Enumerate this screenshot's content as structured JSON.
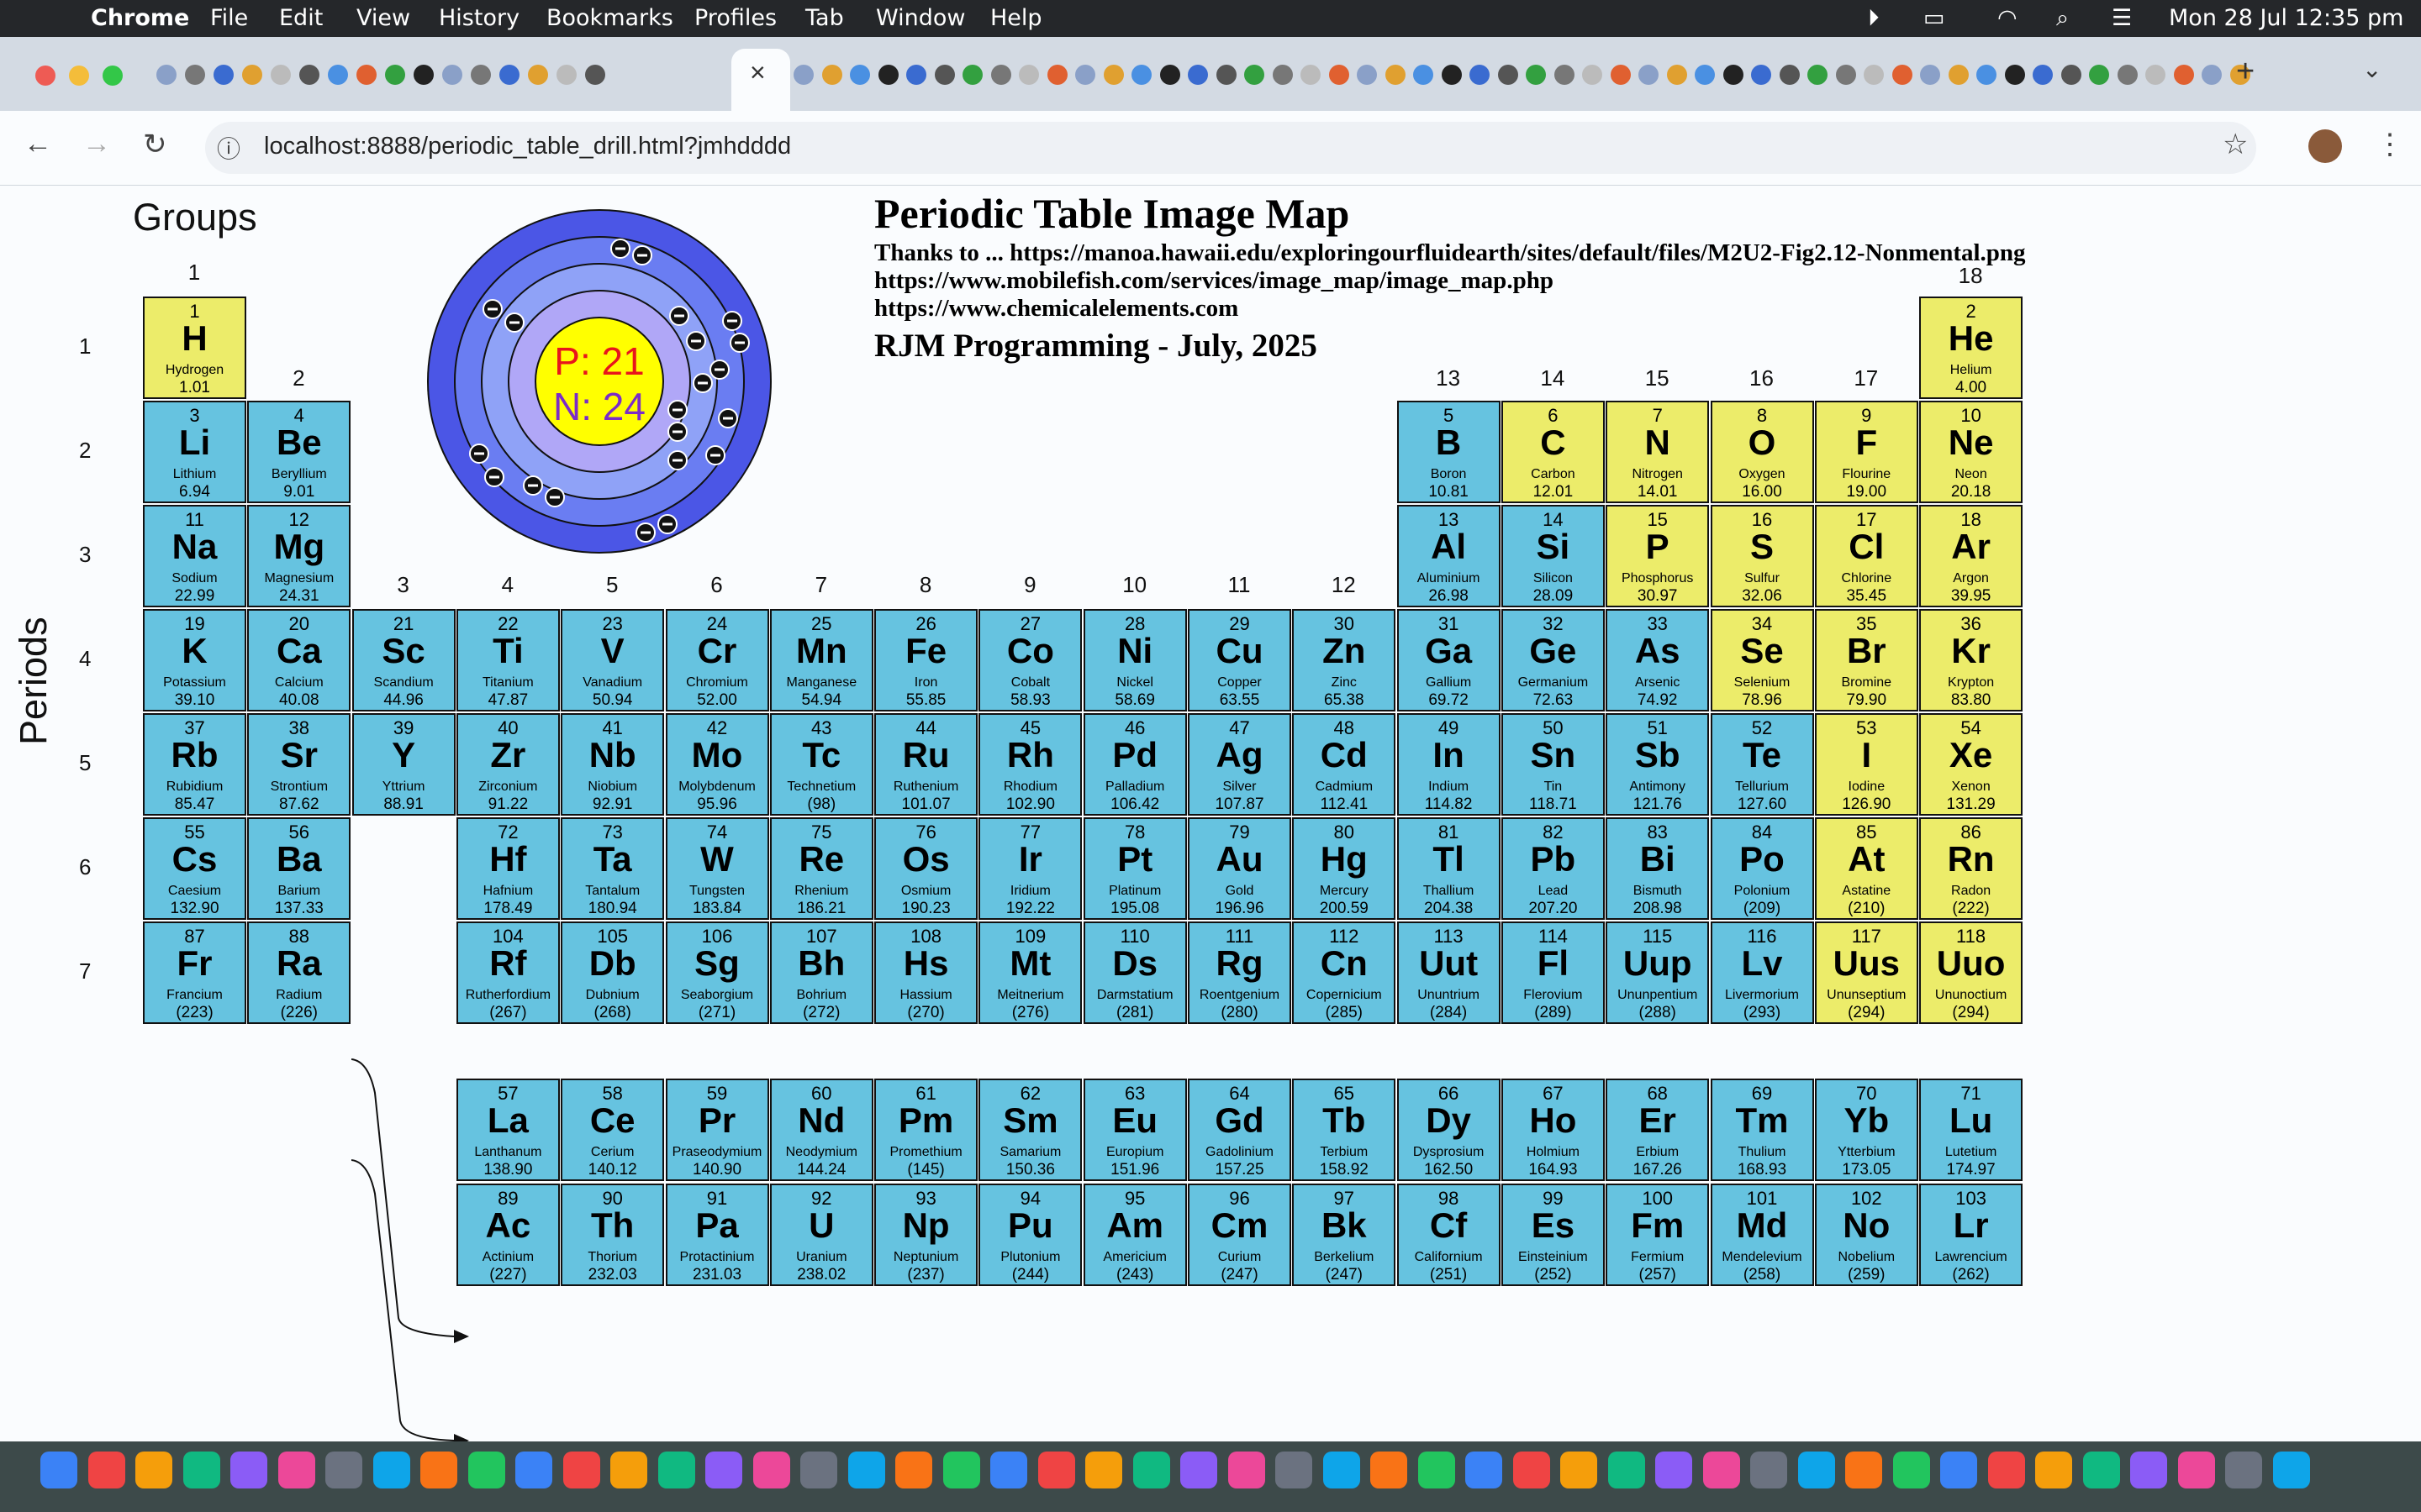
{
  "menubar": {
    "app": "Chrome",
    "items": [
      "File",
      "Edit",
      "View",
      "History",
      "Bookmarks",
      "Profiles",
      "Tab",
      "Window",
      "Help"
    ],
    "clock": "Mon 28 Jul  12:35 pm"
  },
  "browser": {
    "url": "localhost:8888/periodic_table_drill.html?jmhdddd",
    "close_tab": "×",
    "new_tab": "+"
  },
  "page": {
    "title": "Periodic Table Image Map",
    "thanks_line1": "Thanks to ... https://manoa.hawaii.edu/exploringourfluidearth/sites/default/files/M2U2-Fig2.12-Nonmental.png",
    "thanks_line2": "https://www.mobilefish.com/services/image_map/image_map.php",
    "thanks_line3": "https://www.chemicalelements.com",
    "author": "RJM Programming - July, 2025",
    "groups_label": "Groups",
    "periods_label": "Periods",
    "atom": {
      "protons": "P: 21",
      "neutrons": "N: 24"
    }
  },
  "group_numbers": [
    "1",
    "2",
    "3",
    "4",
    "5",
    "6",
    "7",
    "8",
    "9",
    "10",
    "11",
    "12",
    "13",
    "14",
    "15",
    "16",
    "17",
    "18"
  ],
  "period_numbers": [
    "1",
    "2",
    "3",
    "4",
    "5",
    "6",
    "7"
  ],
  "colors": {
    "metal": "#66c3e0",
    "nonmetal": "#ecec6a"
  },
  "elements": [
    {
      "n": "1",
      "s": "H",
      "name": "Hydrogen",
      "m": "1.01",
      "g": 1,
      "p": 1,
      "c": "y"
    },
    {
      "n": "2",
      "s": "He",
      "name": "Helium",
      "m": "4.00",
      "g": 18,
      "p": 1,
      "c": "y"
    },
    {
      "n": "3",
      "s": "Li",
      "name": "Lithium",
      "m": "6.94",
      "g": 1,
      "p": 2,
      "c": "b"
    },
    {
      "n": "4",
      "s": "Be",
      "name": "Beryllium",
      "m": "9.01",
      "g": 2,
      "p": 2,
      "c": "b"
    },
    {
      "n": "5",
      "s": "B",
      "name": "Boron",
      "m": "10.81",
      "g": 13,
      "p": 2,
      "c": "b"
    },
    {
      "n": "6",
      "s": "C",
      "name": "Carbon",
      "m": "12.01",
      "g": 14,
      "p": 2,
      "c": "y"
    },
    {
      "n": "7",
      "s": "N",
      "name": "Nitrogen",
      "m": "14.01",
      "g": 15,
      "p": 2,
      "c": "y"
    },
    {
      "n": "8",
      "s": "O",
      "name": "Oxygen",
      "m": "16.00",
      "g": 16,
      "p": 2,
      "c": "y"
    },
    {
      "n": "9",
      "s": "F",
      "name": "Flourine",
      "m": "19.00",
      "g": 17,
      "p": 2,
      "c": "y"
    },
    {
      "n": "10",
      "s": "Ne",
      "name": "Neon",
      "m": "20.18",
      "g": 18,
      "p": 2,
      "c": "y"
    },
    {
      "n": "11",
      "s": "Na",
      "name": "Sodium",
      "m": "22.99",
      "g": 1,
      "p": 3,
      "c": "b"
    },
    {
      "n": "12",
      "s": "Mg",
      "name": "Magnesium",
      "m": "24.31",
      "g": 2,
      "p": 3,
      "c": "b"
    },
    {
      "n": "13",
      "s": "Al",
      "name": "Aluminium",
      "m": "26.98",
      "g": 13,
      "p": 3,
      "c": "b"
    },
    {
      "n": "14",
      "s": "Si",
      "name": "Silicon",
      "m": "28.09",
      "g": 14,
      "p": 3,
      "c": "b"
    },
    {
      "n": "15",
      "s": "P",
      "name": "Phosphorus",
      "m": "30.97",
      "g": 15,
      "p": 3,
      "c": "y"
    },
    {
      "n": "16",
      "s": "S",
      "name": "Sulfur",
      "m": "32.06",
      "g": 16,
      "p": 3,
      "c": "y"
    },
    {
      "n": "17",
      "s": "Cl",
      "name": "Chlorine",
      "m": "35.45",
      "g": 17,
      "p": 3,
      "c": "y"
    },
    {
      "n": "18",
      "s": "Ar",
      "name": "Argon",
      "m": "39.95",
      "g": 18,
      "p": 3,
      "c": "y"
    },
    {
      "n": "19",
      "s": "K",
      "name": "Potassium",
      "m": "39.10",
      "g": 1,
      "p": 4,
      "c": "b"
    },
    {
      "n": "20",
      "s": "Ca",
      "name": "Calcium",
      "m": "40.08",
      "g": 2,
      "p": 4,
      "c": "b"
    },
    {
      "n": "21",
      "s": "Sc",
      "name": "Scandium",
      "m": "44.96",
      "g": 3,
      "p": 4,
      "c": "b"
    },
    {
      "n": "22",
      "s": "Ti",
      "name": "Titanium",
      "m": "47.87",
      "g": 4,
      "p": 4,
      "c": "b"
    },
    {
      "n": "23",
      "s": "V",
      "name": "Vanadium",
      "m": "50.94",
      "g": 5,
      "p": 4,
      "c": "b"
    },
    {
      "n": "24",
      "s": "Cr",
      "name": "Chromium",
      "m": "52.00",
      "g": 6,
      "p": 4,
      "c": "b"
    },
    {
      "n": "25",
      "s": "Mn",
      "name": "Manganese",
      "m": "54.94",
      "g": 7,
      "p": 4,
      "c": "b"
    },
    {
      "n": "26",
      "s": "Fe",
      "name": "Iron",
      "m": "55.85",
      "g": 8,
      "p": 4,
      "c": "b"
    },
    {
      "n": "27",
      "s": "Co",
      "name": "Cobalt",
      "m": "58.93",
      "g": 9,
      "p": 4,
      "c": "b"
    },
    {
      "n": "28",
      "s": "Ni",
      "name": "Nickel",
      "m": "58.69",
      "g": 10,
      "p": 4,
      "c": "b"
    },
    {
      "n": "29",
      "s": "Cu",
      "name": "Copper",
      "m": "63.55",
      "g": 11,
      "p": 4,
      "c": "b"
    },
    {
      "n": "30",
      "s": "Zn",
      "name": "Zinc",
      "m": "65.38",
      "g": 12,
      "p": 4,
      "c": "b"
    },
    {
      "n": "31",
      "s": "Ga",
      "name": "Gallium",
      "m": "69.72",
      "g": 13,
      "p": 4,
      "c": "b"
    },
    {
      "n": "32",
      "s": "Ge",
      "name": "Germanium",
      "m": "72.63",
      "g": 14,
      "p": 4,
      "c": "b"
    },
    {
      "n": "33",
      "s": "As",
      "name": "Arsenic",
      "m": "74.92",
      "g": 15,
      "p": 4,
      "c": "b"
    },
    {
      "n": "34",
      "s": "Se",
      "name": "Selenium",
      "m": "78.96",
      "g": 16,
      "p": 4,
      "c": "y"
    },
    {
      "n": "35",
      "s": "Br",
      "name": "Bromine",
      "m": "79.90",
      "g": 17,
      "p": 4,
      "c": "y"
    },
    {
      "n": "36",
      "s": "Kr",
      "name": "Krypton",
      "m": "83.80",
      "g": 18,
      "p": 4,
      "c": "y"
    },
    {
      "n": "37",
      "s": "Rb",
      "name": "Rubidium",
      "m": "85.47",
      "g": 1,
      "p": 5,
      "c": "b"
    },
    {
      "n": "38",
      "s": "Sr",
      "name": "Strontium",
      "m": "87.62",
      "g": 2,
      "p": 5,
      "c": "b"
    },
    {
      "n": "39",
      "s": "Y",
      "name": "Yttrium",
      "m": "88.91",
      "g": 3,
      "p": 5,
      "c": "b"
    },
    {
      "n": "40",
      "s": "Zr",
      "name": "Zirconium",
      "m": "91.22",
      "g": 4,
      "p": 5,
      "c": "b"
    },
    {
      "n": "41",
      "s": "Nb",
      "name": "Niobium",
      "m": "92.91",
      "g": 5,
      "p": 5,
      "c": "b"
    },
    {
      "n": "42",
      "s": "Mo",
      "name": "Molybdenum",
      "m": "95.96",
      "g": 6,
      "p": 5,
      "c": "b"
    },
    {
      "n": "43",
      "s": "Tc",
      "name": "Technetium",
      "m": "(98)",
      "g": 7,
      "p": 5,
      "c": "b"
    },
    {
      "n": "44",
      "s": "Ru",
      "name": "Ruthenium",
      "m": "101.07",
      "g": 8,
      "p": 5,
      "c": "b"
    },
    {
      "n": "45",
      "s": "Rh",
      "name": "Rhodium",
      "m": "102.90",
      "g": 9,
      "p": 5,
      "c": "b"
    },
    {
      "n": "46",
      "s": "Pd",
      "name": "Palladium",
      "m": "106.42",
      "g": 10,
      "p": 5,
      "c": "b"
    },
    {
      "n": "47",
      "s": "Ag",
      "name": "Silver",
      "m": "107.87",
      "g": 11,
      "p": 5,
      "c": "b"
    },
    {
      "n": "48",
      "s": "Cd",
      "name": "Cadmium",
      "m": "112.41",
      "g": 12,
      "p": 5,
      "c": "b"
    },
    {
      "n": "49",
      "s": "In",
      "name": "Indium",
      "m": "114.82",
      "g": 13,
      "p": 5,
      "c": "b"
    },
    {
      "n": "50",
      "s": "Sn",
      "name": "Tin",
      "m": "118.71",
      "g": 14,
      "p": 5,
      "c": "b"
    },
    {
      "n": "51",
      "s": "Sb",
      "name": "Antimony",
      "m": "121.76",
      "g": 15,
      "p": 5,
      "c": "b"
    },
    {
      "n": "52",
      "s": "Te",
      "name": "Tellurium",
      "m": "127.60",
      "g": 16,
      "p": 5,
      "c": "b"
    },
    {
      "n": "53",
      "s": "I",
      "name": "Iodine",
      "m": "126.90",
      "g": 17,
      "p": 5,
      "c": "y"
    },
    {
      "n": "54",
      "s": "Xe",
      "name": "Xenon",
      "m": "131.29",
      "g": 18,
      "p": 5,
      "c": "y"
    },
    {
      "n": "55",
      "s": "Cs",
      "name": "Caesium",
      "m": "132.90",
      "g": 1,
      "p": 6,
      "c": "b"
    },
    {
      "n": "56",
      "s": "Ba",
      "name": "Barium",
      "m": "137.33",
      "g": 2,
      "p": 6,
      "c": "b"
    },
    {
      "n": "72",
      "s": "Hf",
      "name": "Hafnium",
      "m": "178.49",
      "g": 4,
      "p": 6,
      "c": "b"
    },
    {
      "n": "73",
      "s": "Ta",
      "name": "Tantalum",
      "m": "180.94",
      "g": 5,
      "p": 6,
      "c": "b"
    },
    {
      "n": "74",
      "s": "W",
      "name": "Tungsten",
      "m": "183.84",
      "g": 6,
      "p": 6,
      "c": "b"
    },
    {
      "n": "75",
      "s": "Re",
      "name": "Rhenium",
      "m": "186.21",
      "g": 7,
      "p": 6,
      "c": "b"
    },
    {
      "n": "76",
      "s": "Os",
      "name": "Osmium",
      "m": "190.23",
      "g": 8,
      "p": 6,
      "c": "b"
    },
    {
      "n": "77",
      "s": "Ir",
      "name": "Iridium",
      "m": "192.22",
      "g": 9,
      "p": 6,
      "c": "b"
    },
    {
      "n": "78",
      "s": "Pt",
      "name": "Platinum",
      "m": "195.08",
      "g": 10,
      "p": 6,
      "c": "b"
    },
    {
      "n": "79",
      "s": "Au",
      "name": "Gold",
      "m": "196.96",
      "g": 11,
      "p": 6,
      "c": "b"
    },
    {
      "n": "80",
      "s": "Hg",
      "name": "Mercury",
      "m": "200.59",
      "g": 12,
      "p": 6,
      "c": "b"
    },
    {
      "n": "81",
      "s": "Tl",
      "name": "Thallium",
      "m": "204.38",
      "g": 13,
      "p": 6,
      "c": "b"
    },
    {
      "n": "82",
      "s": "Pb",
      "name": "Lead",
      "m": "207.20",
      "g": 14,
      "p": 6,
      "c": "b"
    },
    {
      "n": "83",
      "s": "Bi",
      "name": "Bismuth",
      "m": "208.98",
      "g": 15,
      "p": 6,
      "c": "b"
    },
    {
      "n": "84",
      "s": "Po",
      "name": "Polonium",
      "m": "(209)",
      "g": 16,
      "p": 6,
      "c": "b"
    },
    {
      "n": "85",
      "s": "At",
      "name": "Astatine",
      "m": "(210)",
      "g": 17,
      "p": 6,
      "c": "y"
    },
    {
      "n": "86",
      "s": "Rn",
      "name": "Radon",
      "m": "(222)",
      "g": 18,
      "p": 6,
      "c": "y"
    },
    {
      "n": "87",
      "s": "Fr",
      "name": "Francium",
      "m": "(223)",
      "g": 1,
      "p": 7,
      "c": "b"
    },
    {
      "n": "88",
      "s": "Ra",
      "name": "Radium",
      "m": "(226)",
      "g": 2,
      "p": 7,
      "c": "b"
    },
    {
      "n": "104",
      "s": "Rf",
      "name": "Rutherfordium",
      "m": "(267)",
      "g": 4,
      "p": 7,
      "c": "b"
    },
    {
      "n": "105",
      "s": "Db",
      "name": "Dubnium",
      "m": "(268)",
      "g": 5,
      "p": 7,
      "c": "b"
    },
    {
      "n": "106",
      "s": "Sg",
      "name": "Seaborgium",
      "m": "(271)",
      "g": 6,
      "p": 7,
      "c": "b"
    },
    {
      "n": "107",
      "s": "Bh",
      "name": "Bohrium",
      "m": "(272)",
      "g": 7,
      "p": 7,
      "c": "b"
    },
    {
      "n": "108",
      "s": "Hs",
      "name": "Hassium",
      "m": "(270)",
      "g": 8,
      "p": 7,
      "c": "b"
    },
    {
      "n": "109",
      "s": "Mt",
      "name": "Meitnerium",
      "m": "(276)",
      "g": 9,
      "p": 7,
      "c": "b"
    },
    {
      "n": "110",
      "s": "Ds",
      "name": "Darmstatium",
      "m": "(281)",
      "g": 10,
      "p": 7,
      "c": "b"
    },
    {
      "n": "111",
      "s": "Rg",
      "name": "Roentgenium",
      "m": "(280)",
      "g": 11,
      "p": 7,
      "c": "b"
    },
    {
      "n": "112",
      "s": "Cn",
      "name": "Copernicium",
      "m": "(285)",
      "g": 12,
      "p": 7,
      "c": "b"
    },
    {
      "n": "113",
      "s": "Uut",
      "name": "Ununtrium",
      "m": "(284)",
      "g": 13,
      "p": 7,
      "c": "b"
    },
    {
      "n": "114",
      "s": "Fl",
      "name": "Flerovium",
      "m": "(289)",
      "g": 14,
      "p": 7,
      "c": "b"
    },
    {
      "n": "115",
      "s": "Uup",
      "name": "Ununpentium",
      "m": "(288)",
      "g": 15,
      "p": 7,
      "c": "b"
    },
    {
      "n": "116",
      "s": "Lv",
      "name": "Livermorium",
      "m": "(293)",
      "g": 16,
      "p": 7,
      "c": "b"
    },
    {
      "n": "117",
      "s": "Uus",
      "name": "Ununseptium",
      "m": "(294)",
      "g": 17,
      "p": 7,
      "c": "y"
    },
    {
      "n": "118",
      "s": "Uuo",
      "name": "Ununoctium",
      "m": "(294)",
      "g": 18,
      "p": 7,
      "c": "y"
    },
    {
      "n": "57",
      "s": "La",
      "name": "Lanthanum",
      "m": "138.90",
      "g": 4,
      "p": 8,
      "c": "b"
    },
    {
      "n": "58",
      "s": "Ce",
      "name": "Cerium",
      "m": "140.12",
      "g": 5,
      "p": 8,
      "c": "b"
    },
    {
      "n": "59",
      "s": "Pr",
      "name": "Praseodymium",
      "m": "140.90",
      "g": 6,
      "p": 8,
      "c": "b"
    },
    {
      "n": "60",
      "s": "Nd",
      "name": "Neodymium",
      "m": "144.24",
      "g": 7,
      "p": 8,
      "c": "b"
    },
    {
      "n": "61",
      "s": "Pm",
      "name": "Promethium",
      "m": "(145)",
      "g": 8,
      "p": 8,
      "c": "b"
    },
    {
      "n": "62",
      "s": "Sm",
      "name": "Samarium",
      "m": "150.36",
      "g": 9,
      "p": 8,
      "c": "b"
    },
    {
      "n": "63",
      "s": "Eu",
      "name": "Europium",
      "m": "151.96",
      "g": 10,
      "p": 8,
      "c": "b"
    },
    {
      "n": "64",
      "s": "Gd",
      "name": "Gadolinium",
      "m": "157.25",
      "g": 11,
      "p": 8,
      "c": "b"
    },
    {
      "n": "65",
      "s": "Tb",
      "name": "Terbium",
      "m": "158.92",
      "g": 12,
      "p": 8,
      "c": "b"
    },
    {
      "n": "66",
      "s": "Dy",
      "name": "Dysprosium",
      "m": "162.50",
      "g": 13,
      "p": 8,
      "c": "b"
    },
    {
      "n": "67",
      "s": "Ho",
      "name": "Holmium",
      "m": "164.93",
      "g": 14,
      "p": 8,
      "c": "b"
    },
    {
      "n": "68",
      "s": "Er",
      "name": "Erbium",
      "m": "167.26",
      "g": 15,
      "p": 8,
      "c": "b"
    },
    {
      "n": "69",
      "s": "Tm",
      "name": "Thulium",
      "m": "168.93",
      "g": 16,
      "p": 8,
      "c": "b"
    },
    {
      "n": "70",
      "s": "Yb",
      "name": "Ytterbium",
      "m": "173.05",
      "g": 17,
      "p": 8,
      "c": "b"
    },
    {
      "n": "71",
      "s": "Lu",
      "name": "Lutetium",
      "m": "174.97",
      "g": 18,
      "p": 8,
      "c": "b"
    },
    {
      "n": "89",
      "s": "Ac",
      "name": "Actinium",
      "m": "(227)",
      "g": 4,
      "p": 9,
      "c": "b"
    },
    {
      "n": "90",
      "s": "Th",
      "name": "Thorium",
      "m": "232.03",
      "g": 5,
      "p": 9,
      "c": "b"
    },
    {
      "n": "91",
      "s": "Pa",
      "name": "Protactinium",
      "m": "231.03",
      "g": 6,
      "p": 9,
      "c": "b"
    },
    {
      "n": "92",
      "s": "U",
      "name": "Uranium",
      "m": "238.02",
      "g": 7,
      "p": 9,
      "c": "b"
    },
    {
      "n": "93",
      "s": "Np",
      "name": "Neptunium",
      "m": "(237)",
      "g": 8,
      "p": 9,
      "c": "b"
    },
    {
      "n": "94",
      "s": "Pu",
      "name": "Plutonium",
      "m": "(244)",
      "g": 9,
      "p": 9,
      "c": "b"
    },
    {
      "n": "95",
      "s": "Am",
      "name": "Americium",
      "m": "(243)",
      "g": 10,
      "p": 9,
      "c": "b"
    },
    {
      "n": "96",
      "s": "Cm",
      "name": "Curium",
      "m": "(247)",
      "g": 11,
      "p": 9,
      "c": "b"
    },
    {
      "n": "97",
      "s": "Bk",
      "name": "Berkelium",
      "m": "(247)",
      "g": 12,
      "p": 9,
      "c": "b"
    },
    {
      "n": "98",
      "s": "Cf",
      "name": "Californium",
      "m": "(251)",
      "g": 13,
      "p": 9,
      "c": "b"
    },
    {
      "n": "99",
      "s": "Es",
      "name": "Einsteinium",
      "m": "(252)",
      "g": 14,
      "p": 9,
      "c": "b"
    },
    {
      "n": "100",
      "s": "Fm",
      "name": "Fermium",
      "m": "(257)",
      "g": 15,
      "p": 9,
      "c": "b"
    },
    {
      "n": "101",
      "s": "Md",
      "name": "Mendelevium",
      "m": "(258)",
      "g": 16,
      "p": 9,
      "c": "b"
    },
    {
      "n": "102",
      "s": "No",
      "name": "Nobelium",
      "m": "(259)",
      "g": 17,
      "p": 9,
      "c": "b"
    },
    {
      "n": "103",
      "s": "Lr",
      "name": "Lawrencium",
      "m": "(262)",
      "g": 18,
      "p": 9,
      "c": "b"
    }
  ]
}
